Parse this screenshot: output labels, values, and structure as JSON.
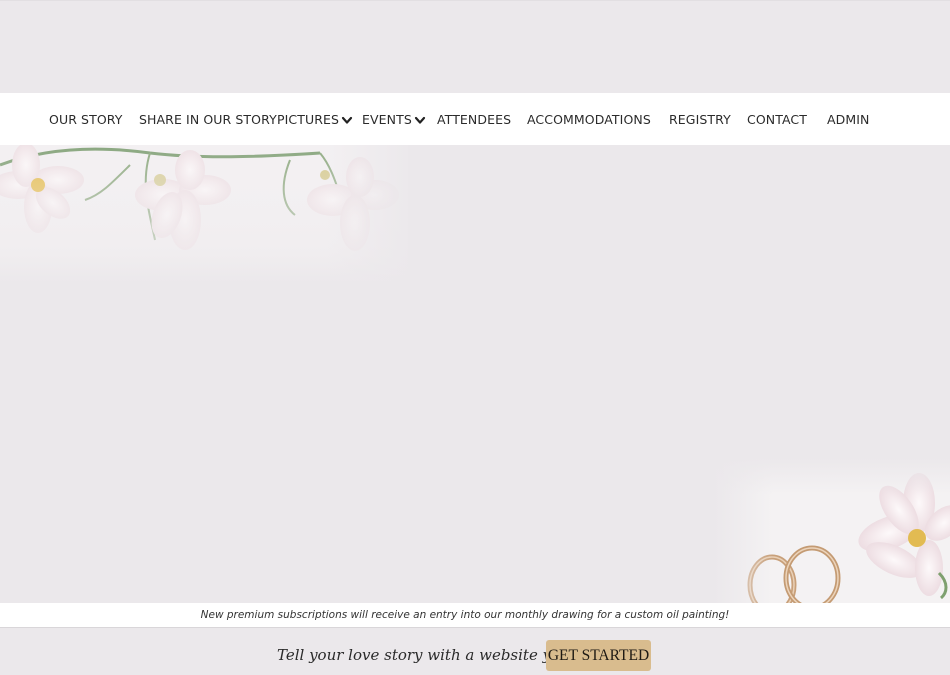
{
  "nav": {
    "items": [
      {
        "label": "OUR STORY",
        "dropdown": false
      },
      {
        "label": "SHARE IN OUR STORY",
        "dropdown": false
      },
      {
        "label": "PICTURES",
        "dropdown": true
      },
      {
        "label": "EVENTS",
        "dropdown": true
      },
      {
        "label": "ATTENDEES",
        "dropdown": false
      },
      {
        "label": "ACCOMMODATIONS",
        "dropdown": false
      },
      {
        "label": "REGISTRY",
        "dropdown": false
      },
      {
        "label": "CONTACT",
        "dropdown": false
      },
      {
        "label": "ADMIN",
        "dropdown": false
      }
    ]
  },
  "promo": {
    "text": "New premium subscriptions will receive an entry into our monthly drawing for a custom oil painting!"
  },
  "cta": {
    "text": "Tell your love story with a website you create!",
    "button_label": "GET STARTED"
  },
  "colors": {
    "background": "#ebe8eb",
    "nav_background": "#ffffff",
    "button": "#d9bc8e"
  },
  "images": {
    "top_banner": "white-cosmos-flowers",
    "bottom_corner": "wedding-rings-with-flower"
  }
}
